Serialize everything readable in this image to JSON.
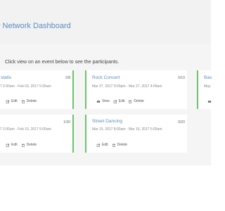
{
  "header": {
    "title": "y Network Dashboard"
  },
  "instructions": "Click view on an event below to see the participants.",
  "cards": [
    {
      "title": "statis",
      "dates": "7 2:00am - Feb 03, 2017 5:00am",
      "count": "2/8",
      "actions": {
        "edit": "Edit",
        "delete": "Delete"
      }
    },
    {
      "title": "Rock Concert",
      "dates": "Mar 27, 2017 9:00pm - Mar 27, 2017 4:00am",
      "count": "0/10",
      "actions": {
        "view": "View",
        "edit": "Edit",
        "delete": "Delete"
      }
    },
    {
      "title": "Bas",
      "dates": "May",
      "count": "",
      "actions": {}
    },
    {
      "title": "",
      "dates": "7 2:00am - Feb 16, 2017 5:00am",
      "count": "1/30",
      "actions": {
        "edit": "Edit",
        "delete": "Delete"
      }
    },
    {
      "title": "Street Dancing",
      "dates": "Mar 15, 2017 8:00am - Mar 16, 2017 5:00am",
      "count": "0/20",
      "actions": {
        "edit": "Edit",
        "delete": "Delete"
      }
    }
  ],
  "colors": {
    "accent_blue": "#5b8dc0",
    "active_green": "#6cc36b",
    "header_bg": "#f2f2f2",
    "content_bg": "#f5f5f5"
  }
}
